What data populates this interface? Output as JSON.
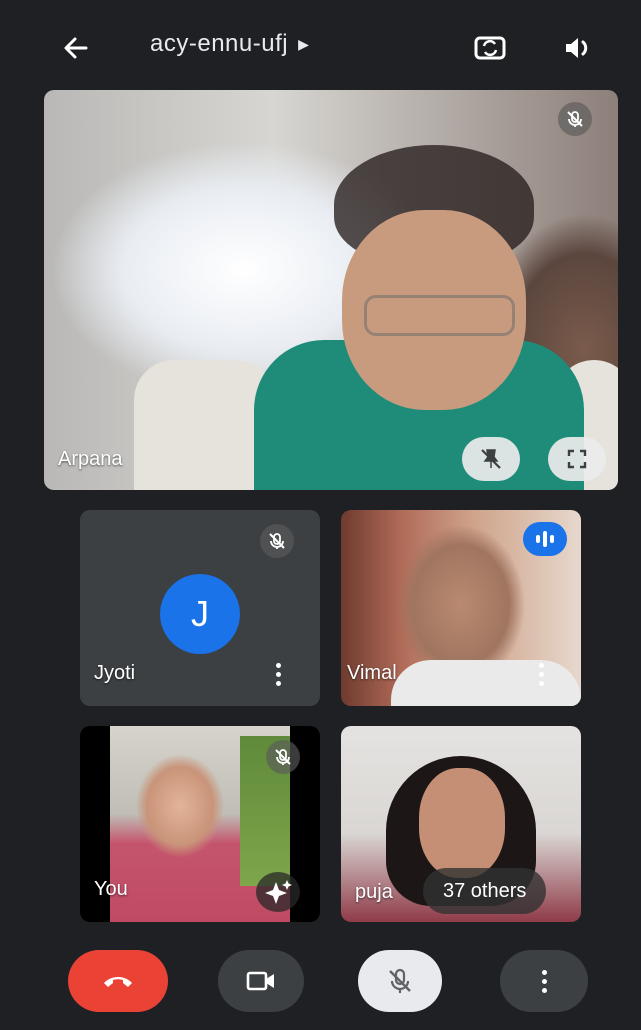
{
  "header": {
    "meeting_code": "acy-ennu-ufj",
    "icons": {
      "back": "arrow-left-icon",
      "details": "caret-right-icon",
      "switch_camera": "switch-camera-icon",
      "audio": "speaker-icon"
    }
  },
  "main_tile": {
    "name": "Arpana",
    "muted": true
  },
  "tiles": [
    {
      "name": "Jyoti",
      "initial": "J",
      "muted": true,
      "avatar_color": "#1a73e8"
    },
    {
      "name": "Vimal",
      "speaking": true
    },
    {
      "name": "You",
      "muted": true
    },
    {
      "name": "puja",
      "others_label": "37 others"
    }
  ],
  "controls": {
    "end_call_color": "#ea4335",
    "items": [
      "end-call",
      "camera",
      "microphone-muted",
      "more-options"
    ]
  },
  "colors": {
    "background": "#1f2023",
    "accent": "#1a73e8",
    "tile": "#3c4043"
  }
}
